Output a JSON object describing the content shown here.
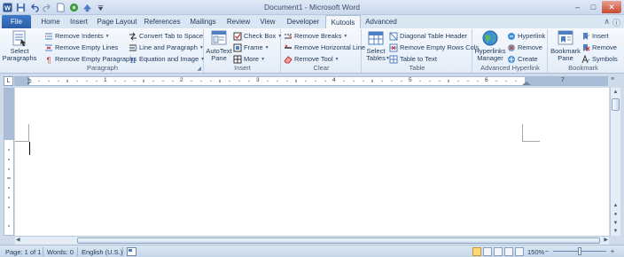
{
  "window": {
    "title": "Document1 - Microsoft Word",
    "controls": [
      "minimize",
      "maximize",
      "close"
    ]
  },
  "quick_access": [
    "word-logo-icon",
    "save-icon",
    "undo-icon",
    "redo-icon",
    "new-document-icon",
    "print-icon",
    "kutools-icon",
    "customize-icon"
  ],
  "tabs": {
    "file": "File",
    "items": [
      "Home",
      "Insert",
      "Page Layout",
      "References",
      "Mailings",
      "Review",
      "View",
      "Developer",
      "Kutools",
      "Advanced"
    ],
    "active": "Kutools"
  },
  "ribbon": {
    "paragraph": {
      "label": "Paragraph",
      "select_paragraphs": "Select Paragraphs",
      "remove_indents": "Remove Indents",
      "remove_empty_lines": "Remove Empty Lines",
      "remove_empty_paragraphs": "Remove Empty Paragraphs",
      "convert_tab": "Convert Tab to Space",
      "line_paragraph": "Line and Paragraph",
      "equation_image": "Equation and Image"
    },
    "insert": {
      "label": "Insert",
      "autotext_pane": "AutoText Pane",
      "check_box": "Check Box",
      "frame": "Frame",
      "more": "More"
    },
    "clear": {
      "label": "Clear",
      "remove_breaks": "Remove Breaks",
      "remove_horizontal_line": "Remove Horizontal Line",
      "remove_tool": "Remove Tool"
    },
    "table": {
      "label": "Table",
      "select_tables": "Select Tables",
      "diagonal_header": "Diagonal Table Header",
      "remove_empty_rows": "Remove Empty Rows Cols",
      "table_to_text": "Table to Text"
    },
    "advanced_hyperlink": {
      "label": "Advanced Hyperlink",
      "hyperlinks_manager": "Hyperlinks Manager",
      "hyperlink": "Hyperlink",
      "remove": "Remove",
      "create": "Create"
    },
    "bookmark": {
      "label": "Bookmark",
      "bookmark_pane": "Bookmark Pane",
      "insert": "Insert",
      "remove": "Remove",
      "symbols": "Symbols"
    }
  },
  "ruler": {
    "tab_selector": "L",
    "numbers": [
      "1",
      "2",
      "3",
      "4",
      "5",
      "6",
      "7"
    ]
  },
  "status": {
    "page": "Page: 1 of 1",
    "words": "Words: 0",
    "language": "English (U.S.)",
    "zoom": "150%"
  },
  "colors": {
    "file_tab": "#2a5ea7",
    "ribbon_bg": "#e3ecf7",
    "workspace_bg": "#cfdbea"
  }
}
